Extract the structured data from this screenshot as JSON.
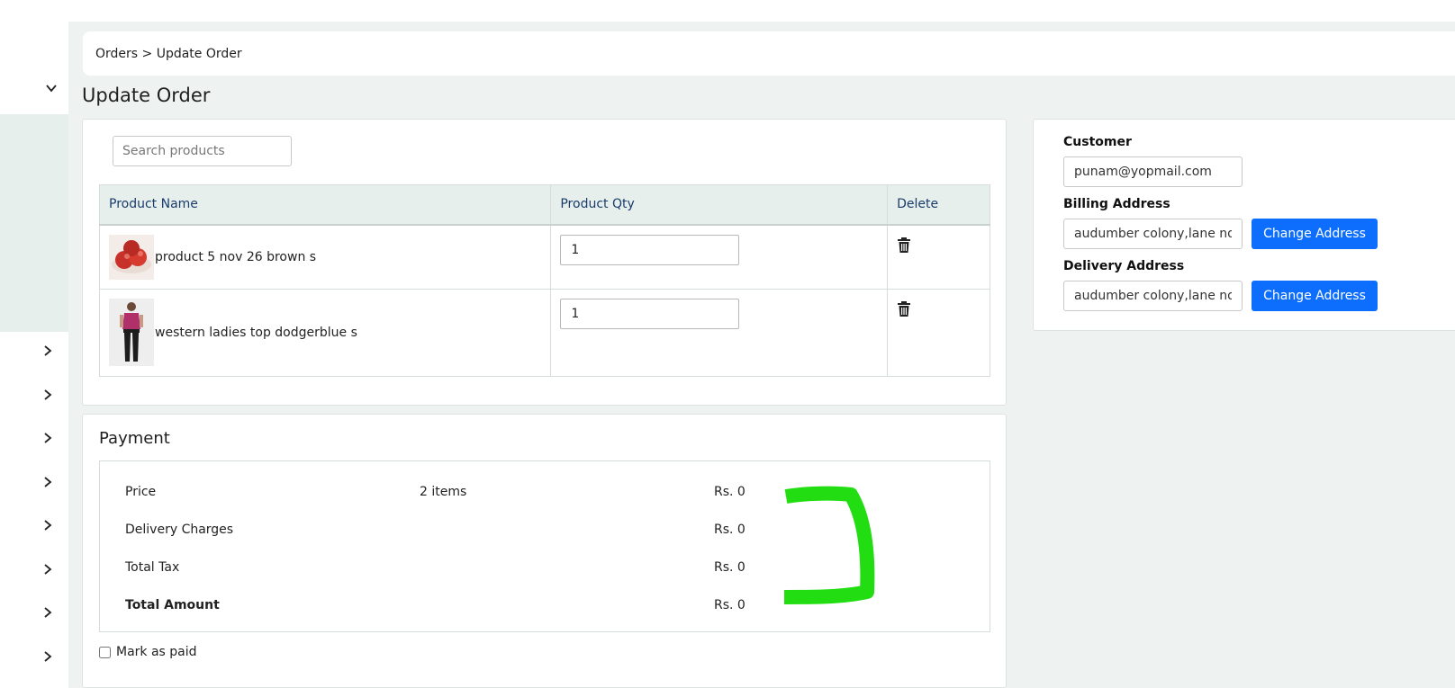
{
  "breadcrumb": "Orders > Update Order",
  "page_title": "Update Order",
  "search": {
    "placeholder": "Search products"
  },
  "table": {
    "headers": [
      "Product Name",
      "Product Qty",
      "Delete"
    ],
    "rows": [
      {
        "name": "product 5 nov 26 brown s",
        "qty": "1",
        "image_icon": "apples-thumbnail"
      },
      {
        "name": "western ladies top dodgerblue s",
        "qty": "1",
        "image_icon": "woman-top-thumbnail"
      }
    ]
  },
  "payment": {
    "title": "Payment",
    "rows": [
      {
        "label": "Price",
        "middle": "2 items",
        "amount": "Rs. 0"
      },
      {
        "label": "Delivery Charges",
        "middle": "",
        "amount": "Rs. 0"
      },
      {
        "label": "Total Tax",
        "middle": "",
        "amount": "Rs. 0"
      },
      {
        "label": "Total Amount",
        "middle": "",
        "amount": "Rs. 0"
      }
    ],
    "mark_paid_label": "Mark as paid",
    "mark_paid_checked": false
  },
  "customer": {
    "customer_label": "Customer",
    "customer_value": "punam@yopmail.com",
    "billing_label": "Billing Address",
    "billing_value": "audumber colony,lane no",
    "delivery_label": "Delivery Address",
    "delivery_value": "audumber colony,lane no",
    "change_address_label": "Change Address"
  },
  "colors": {
    "accent": "#0d6efd",
    "table_header_bg": "#e6efec",
    "table_header_text": "#1a3c6b",
    "annotation": "#22dd11"
  },
  "sidebar_icons": [
    "chevron-down-icon",
    "chevron-right-icon",
    "chevron-right-icon",
    "chevron-right-icon",
    "chevron-right-icon",
    "chevron-right-icon",
    "chevron-right-icon",
    "chevron-right-icon",
    "chevron-right-icon"
  ]
}
